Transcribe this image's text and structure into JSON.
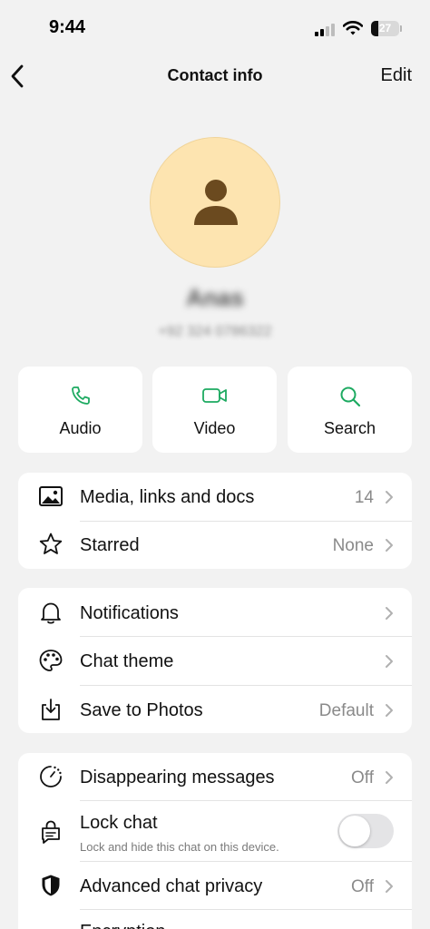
{
  "status_bar": {
    "time": "9:44",
    "battery_level": "27",
    "battery_fraction": 0.27
  },
  "nav": {
    "back_icon": "chevron-left-icon",
    "title": "Contact info",
    "edit_label": "Edit"
  },
  "contact": {
    "avatar_icon": "person-icon",
    "name": "Anas",
    "phone": "+92 324 0786322"
  },
  "actions": [
    {
      "label": "Audio",
      "icon": "phone-icon"
    },
    {
      "label": "Video",
      "icon": "video-camera-icon"
    },
    {
      "label": "Search",
      "icon": "search-icon"
    }
  ],
  "section1": {
    "rows": [
      {
        "label": "Media, links and docs",
        "value": "14",
        "icon": "image-icon"
      },
      {
        "label": "Starred",
        "value": "None",
        "icon": "star-icon"
      }
    ]
  },
  "section2": {
    "rows": [
      {
        "label": "Notifications",
        "value": "",
        "icon": "bell-icon"
      },
      {
        "label": "Chat theme",
        "value": "",
        "icon": "palette-icon"
      },
      {
        "label": "Save to Photos",
        "value": "Default",
        "icon": "save-download-icon"
      }
    ]
  },
  "section3": {
    "rows": [
      {
        "label": "Disappearing messages",
        "value": "Off",
        "icon": "timer-icon"
      },
      {
        "label": "Lock chat",
        "subtitle": "Lock and hide this chat on this device.",
        "toggle_on": false,
        "icon": "lock-chat-icon"
      },
      {
        "label": "Advanced chat privacy",
        "value": "Off",
        "icon": "shield-icon"
      },
      {
        "label": "Encryption",
        "icon": "encryption-icon"
      }
    ]
  },
  "colors": {
    "accent": "#1daa61",
    "background": "#f2f2f2",
    "avatar_bg": "#fde4b0",
    "avatar_fg": "#6b4a1f"
  }
}
